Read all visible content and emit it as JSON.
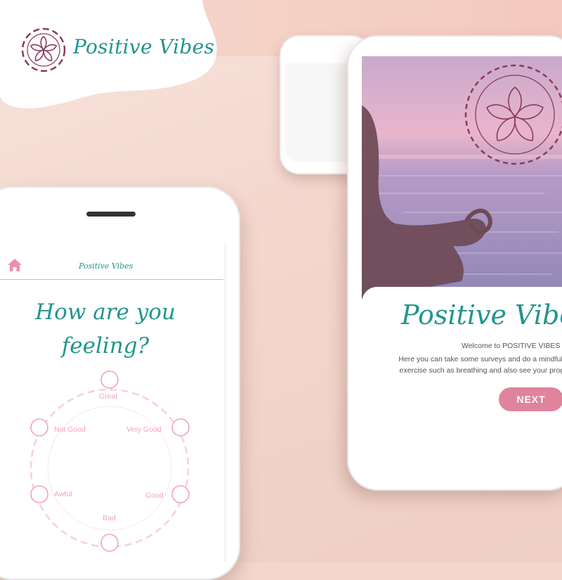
{
  "brand": {
    "name": "Positive Vibes",
    "accent_color": "#21958d",
    "pink_color": "#e0849d",
    "plum_color": "#8a3b5c",
    "logo_icon": "lotus-flower-icon"
  },
  "welcome_screen": {
    "title": "Positive Vibes",
    "welcome_text": "Welcome to POSITIVE VIBES",
    "description": "Here you can take some surveys and do a mindfulness exercise such as breathing and also see your progress",
    "next_button": "NEXT",
    "badge_icon": "lotus-flower-icon",
    "photo_subject": "meditation-pose-photo"
  },
  "mood_screen": {
    "nav": {
      "home_icon": "home-icon",
      "title": "Positive Vibes"
    },
    "question": "How are you feeling?",
    "moods": {
      "great": "Great",
      "very_good": "Very Good",
      "good": "Good",
      "bad": "Bad",
      "awful": "Awful",
      "not_good": "Not Good"
    }
  }
}
